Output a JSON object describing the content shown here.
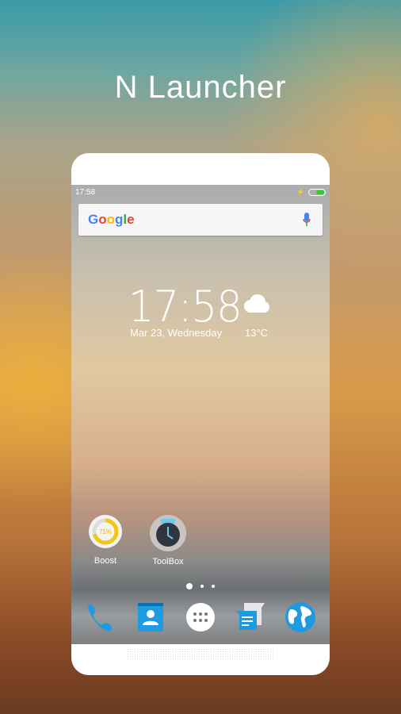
{
  "promo_title": "N Launcher",
  "status_bar": {
    "time": "17:58",
    "battery_icon": "battery-charging-icon"
  },
  "search": {
    "logo": "Google",
    "icon": "mic-icon"
  },
  "clock_widget": {
    "time": "17:58",
    "date": "Mar 23, Wednesday",
    "temperature": "13°C",
    "weather_icon": "cloud-icon"
  },
  "apps": [
    {
      "label": "Boost",
      "percent": "71%"
    },
    {
      "label": "ToolBox"
    }
  ],
  "page_indicator": {
    "pages": 3,
    "current": 1
  },
  "dock": [
    "phone-icon",
    "contacts-icon",
    "app-drawer-icon",
    "messages-icon",
    "browser-globe-icon"
  ],
  "colors": {
    "dock_blue": "#1e9be0",
    "boost_yellow": "#f5c518"
  }
}
